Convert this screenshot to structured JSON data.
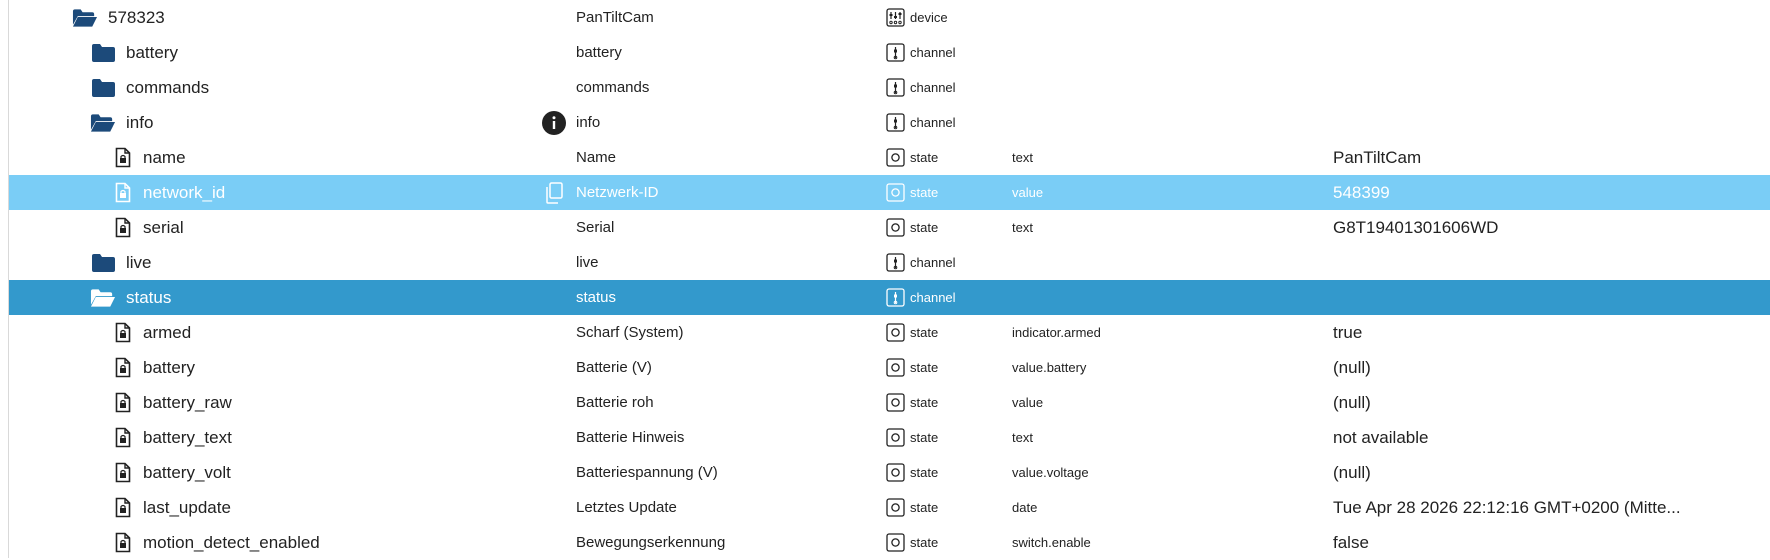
{
  "colors": {
    "selected_light": "#7acdf6",
    "selected_dark": "#3399cc",
    "folder_blue": "#1c4a7a"
  },
  "rows": [
    {
      "id": "578323",
      "name": "PanTiltCam",
      "type": "device",
      "role": "",
      "value": "",
      "icon": "folder-open-icon",
      "type_icon": "device-icon",
      "level": 0,
      "state": "normal"
    },
    {
      "id": "battery",
      "name": "battery",
      "type": "channel",
      "role": "",
      "value": "",
      "icon": "folder-icon",
      "type_icon": "channel-icon",
      "level": 1,
      "state": "normal"
    },
    {
      "id": "commands",
      "name": "commands",
      "type": "channel",
      "role": "",
      "value": "",
      "icon": "folder-icon",
      "type_icon": "channel-icon",
      "level": 1,
      "state": "normal"
    },
    {
      "id": "info",
      "name": "info",
      "type": "channel",
      "role": "",
      "value": "",
      "icon": "folder-open-icon",
      "type_icon": "channel-icon",
      "level": 1,
      "state": "normal",
      "extra": "info-icon"
    },
    {
      "id": "name",
      "name": "Name",
      "type": "state",
      "role": "text",
      "value": "PanTiltCam",
      "icon": "file-lock-icon",
      "type_icon": "state-icon",
      "level": 2,
      "state": "normal"
    },
    {
      "id": "network_id",
      "name": "Netzwerk-ID",
      "type": "state",
      "role": "value",
      "value": "548399",
      "icon": "file-lock-icon",
      "type_icon": "state-icon",
      "level": 2,
      "state": "sel-light",
      "extra": "copy-icon"
    },
    {
      "id": "serial",
      "name": "Serial",
      "type": "state",
      "role": "text",
      "value": "G8T19401301606WD",
      "icon": "file-lock-icon",
      "type_icon": "state-icon",
      "level": 2,
      "state": "normal"
    },
    {
      "id": "live",
      "name": "live",
      "type": "channel",
      "role": "",
      "value": "",
      "icon": "folder-icon",
      "type_icon": "channel-icon",
      "level": 1,
      "state": "normal"
    },
    {
      "id": "status",
      "name": "status",
      "type": "channel",
      "role": "",
      "value": "",
      "icon": "folder-open-icon",
      "type_icon": "channel-icon",
      "level": 1,
      "state": "sel-dark"
    },
    {
      "id": "armed",
      "name": "Scharf (System)",
      "type": "state",
      "role": "indicator.armed",
      "value": "true",
      "icon": "file-lock-icon",
      "type_icon": "state-icon",
      "level": 2,
      "state": "normal"
    },
    {
      "id": "battery",
      "name": "Batterie (V)",
      "type": "state",
      "role": "value.battery",
      "value": "(null)",
      "icon": "file-lock-icon",
      "type_icon": "state-icon",
      "level": 2,
      "state": "normal"
    },
    {
      "id": "battery_raw",
      "name": "Batterie roh",
      "type": "state",
      "role": "value",
      "value": "(null)",
      "icon": "file-lock-icon",
      "type_icon": "state-icon",
      "level": 2,
      "state": "normal"
    },
    {
      "id": "battery_text",
      "name": "Batterie Hinweis",
      "type": "state",
      "role": "text",
      "value": "not available",
      "icon": "file-lock-icon",
      "type_icon": "state-icon",
      "level": 2,
      "state": "normal"
    },
    {
      "id": "battery_volt",
      "name": "Batteriespannung (V)",
      "type": "state",
      "role": "value.voltage",
      "value": "(null)",
      "icon": "file-lock-icon",
      "type_icon": "state-icon",
      "level": 2,
      "state": "normal"
    },
    {
      "id": "last_update",
      "name": "Letztes Update",
      "type": "state",
      "role": "date",
      "value": "Tue Apr 28 2026 22:12:16 GMT+0200 (Mitte...",
      "icon": "file-lock-icon",
      "type_icon": "state-icon",
      "level": 2,
      "state": "normal"
    },
    {
      "id": "motion_detect_enabled",
      "name": "Bewegungserkennung",
      "type": "state",
      "role": "switch.enable",
      "value": "false",
      "icon": "file-lock-icon",
      "type_icon": "state-icon",
      "level": 2,
      "state": "normal"
    }
  ]
}
